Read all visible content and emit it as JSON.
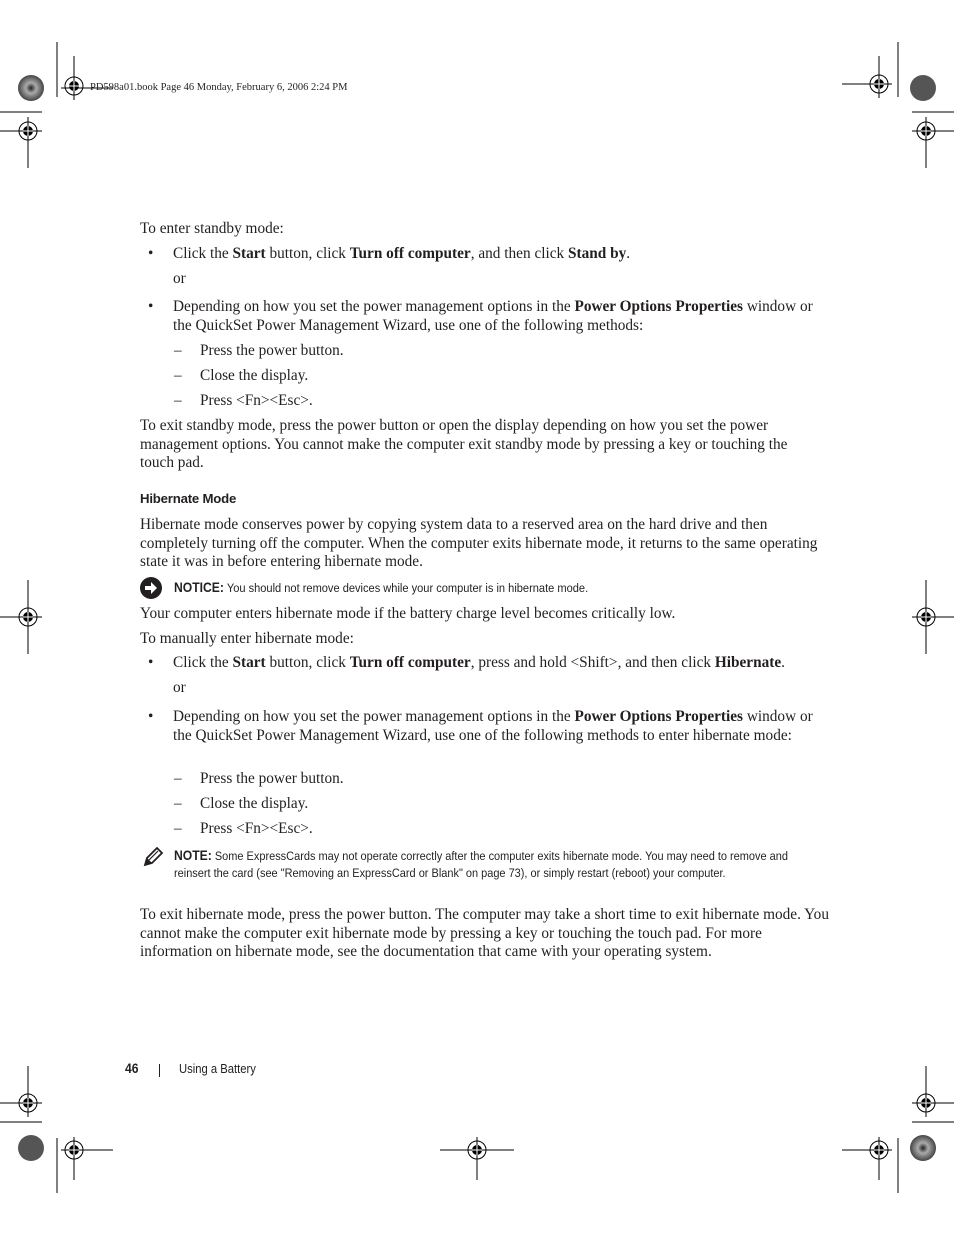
{
  "slug": "PD598a01.book  Page 46  Monday, February 6, 2006  2:24 PM",
  "standby": {
    "intro": "To enter standby mode:",
    "bullet1": {
      "p1": "Click the ",
      "b1": "Start",
      "p2": " button, click ",
      "b2": "Turn off computer",
      "p3": ", and then click ",
      "b3": "Stand by",
      "p4": "."
    },
    "or": "or",
    "bullet2": {
      "p1": "Depending on how you set the power management options in the ",
      "b1": "Power Options Properties",
      "p2": " window or the QuickSet Power Management Wizard, use one of the following methods:"
    },
    "methods": [
      "Press the power button.",
      "Close the display.",
      "Press <Fn><Esc>."
    ],
    "exit": "To exit standby mode, press the power button or open the display depending on how you set the power management options. You cannot make the computer exit standby mode by pressing a key or touching the touch pad."
  },
  "hibernate": {
    "heading": "Hibernate Mode",
    "intro": "Hibernate mode conserves power by copying system data to a reserved area on the hard drive and then completely turning off the computer. When the computer exits hibernate mode, it returns to the same operating state it was in before entering hibernate mode.",
    "notice": {
      "icon": "notice-arrow-icon",
      "label": "NOTICE:",
      "text": " You should not remove devices while your computer is in hibernate mode."
    },
    "battery_low": "Your computer enters hibernate mode if the battery charge level becomes critically low.",
    "manual_intro": "To manually enter hibernate mode:",
    "bullet1": {
      "p1": "Click the ",
      "b1": "Start",
      "p2": " button, click ",
      "b2": "Turn off computer",
      "p3": ", press and hold <Shift>, and then click ",
      "b3": "Hibernate",
      "p4": "."
    },
    "or": "or",
    "bullet2": {
      "p1": "Depending on how you set the power management options in the ",
      "b1": "Power Options Properties",
      "p2": " window or the QuickSet Power Management Wizard, use one of the following methods to enter hibernate mode:"
    },
    "methods": [
      "Press the power button.",
      "Close the display.",
      "Press <Fn><Esc>."
    ],
    "note": {
      "icon": "note-pencil-icon",
      "label": "NOTE:",
      "text": " Some ExpressCards may not operate correctly after the computer exits hibernate mode. You may need to remove and reinsert the card (see \"Removing an ExpressCard or Blank\" on page 73), or simply restart (reboot) your computer."
    },
    "exit": "To exit hibernate mode, press the power button. The computer may take a short time to exit hibernate mode. You cannot make the computer exit hibernate mode by pressing a key or touching the touch pad. For more information on hibernate mode, see the documentation that came with your operating system."
  },
  "footer": {
    "page_number": "46",
    "separator": "|",
    "section_title": "Using a Battery"
  }
}
